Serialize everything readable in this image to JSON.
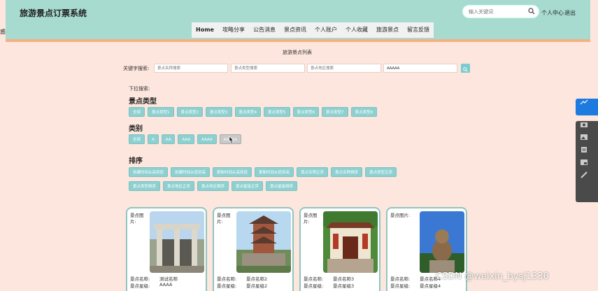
{
  "header": {
    "site_title": "旅游景点订票系统",
    "search_placeholder": "输入关键词",
    "user_center": "个人中心",
    "logout": "退出",
    "left_mark": "惑"
  },
  "nav": {
    "items": [
      "Home",
      "攻略分享",
      "公告消息",
      "景点资讯",
      "个人账户",
      "个人收藏",
      "旅游景点",
      "留言反馈"
    ],
    "active_index": 0
  },
  "list_title": "旅游景点列表",
  "keyword_search": {
    "label": "关键字搜索:",
    "placeholders": [
      "景点名称搜索",
      "景点类型搜索",
      "景点地区搜索"
    ],
    "grade_value": "AAAAA"
  },
  "dropdown_label": "下拉搜索:",
  "sections": {
    "type": {
      "title": "景点类型",
      "options": [
        "全部",
        "景点类型1",
        "景点类型2",
        "景点类型3",
        "景点类型4",
        "景点类型5",
        "景点类型6",
        "景点类型7",
        "景点类型8"
      ]
    },
    "category": {
      "title": "类别",
      "options": [
        "全部",
        "A",
        "AA",
        "AAA",
        "AAAA",
        "AAAAA"
      ],
      "hover_index": 5
    },
    "sort": {
      "title": "排序",
      "row1": [
        "创建时间从高到低",
        "创建时间从低到高",
        "更新时间从高到低",
        "更新时间从低到高",
        "景点名称正序",
        "景点名称倒序",
        "景点类型正序"
      ],
      "row2": [
        "景点类型倒序",
        "景点地区正序",
        "景点地区倒序",
        "景点星级正序",
        "景点星级倒序"
      ]
    }
  },
  "cards": [
    {
      "img_label": "景点图片:",
      "name_label": "景点名称:",
      "name": "测试名称",
      "grade_label": "景点星级:",
      "grade": "AAAA"
    },
    {
      "img_label": "景点图片:",
      "name_label": "景点名称:",
      "name": "景点名称2",
      "grade_label": "景点星级:",
      "grade": "景点星级2"
    },
    {
      "img_label": "景点图片:",
      "name_label": "景点名称:",
      "name": "景点名称3",
      "grade_label": "景点星级:",
      "grade": "景点星级3"
    },
    {
      "img_label": "景点图片:",
      "name_label": "景点名称:",
      "name": "景点名称4",
      "grade_label": "景点星级:",
      "grade": "景点星级4"
    }
  ],
  "watermark": "CSDN @weixin_bysj1330",
  "colors": {
    "header_bg": "#a7dbd0",
    "page_bg": "#fde6dd",
    "accent_bar": "#f4b183",
    "pill": "#8ed0d0",
    "card_border": "#8ec6c0"
  }
}
